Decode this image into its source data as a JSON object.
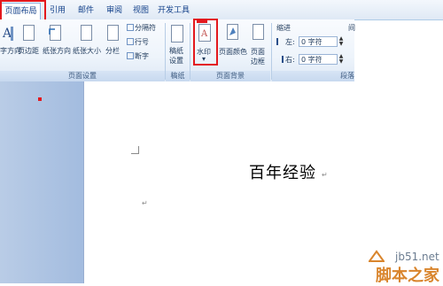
{
  "tabs": [
    {
      "label": "页面布局",
      "active": true
    },
    {
      "label": "引用"
    },
    {
      "label": "邮件"
    },
    {
      "label": "审阅"
    },
    {
      "label": "视图"
    },
    {
      "label": "开发工具"
    }
  ],
  "page_setup": {
    "direction_label": "字方向",
    "margins_label": "页边距",
    "orientation_label": "纸张方向",
    "size_label": "纸张大小",
    "columns_label": "分栏",
    "breaks_label": "分隔符",
    "line_numbers_label": "行号",
    "hyphenation_label": "断字",
    "group_label": "页面设置"
  },
  "manuscript": {
    "label_line1": "稿纸",
    "label_line2": "设置",
    "group_label": "稿纸"
  },
  "page_background": {
    "watermark_label": "水印",
    "page_color_label": "页面颜色",
    "page_border_line1": "页面",
    "page_border_line2": "边框",
    "group_label": "页面背景"
  },
  "paragraph": {
    "indent_title": "缩进",
    "left_label": "左:",
    "left_value": "0 字符",
    "right_label": "右:",
    "right_value": "0 字符",
    "spacing_title": "间",
    "group_label": "段落"
  },
  "document": {
    "text": "百年经验",
    "para_mark": "↵"
  },
  "watermark_site": {
    "url": "jb51.net",
    "name": "脚本之家"
  },
  "colors": {
    "highlight_red": "#e3181d",
    "ribbon_text": "#1e395b"
  }
}
